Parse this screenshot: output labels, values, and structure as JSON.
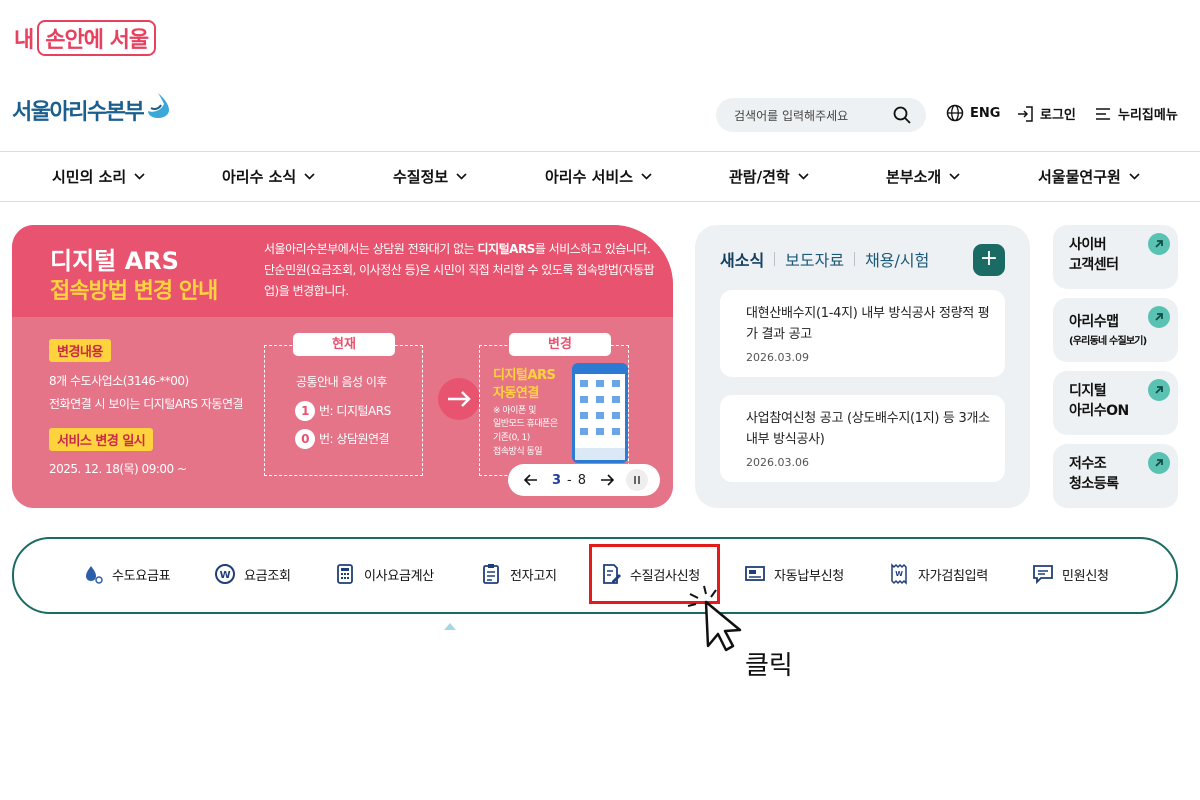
{
  "badge": {
    "prefix": "내",
    "boxed": "손안에 서울"
  },
  "header": {
    "logo_text": "서울아리수본부",
    "search_placeholder": "검색어를 입력해주세요",
    "lang_label": "ENG",
    "login_label": "로그인",
    "sitemap_label": "누리집메뉴"
  },
  "gnb": [
    "시민의 소리",
    "아리수 소식",
    "수질정보",
    "아리수 서비스",
    "관람/견학",
    "본부소개",
    "서울물연구원"
  ],
  "banner": {
    "title": "디지털 ARS",
    "subtitle": "접속방법 변경 안내",
    "desc_1": "서울아리수본부에서는 상담원 전화대기 없는 ",
    "desc_bold": "디지털ARS",
    "desc_2": "를 서비스하고 있습니다. 단순민원(요금조회, 이사정산 등)은 시민이 직접 처리할 수 있도록 접속방법(자동팝업)을 변경합니다.",
    "change_tag": "변경내용",
    "change_line1": "8개 수도사업소(3146-**00)",
    "change_line2": "전화연결 시 보이는 디지털ARS 자동연결",
    "date_tag": "서비스 변경 일시",
    "date_text": "2025. 12. 18(목) 09:00 ~",
    "current_label": "현재",
    "current_line": "공통안내 음성 이후",
    "current_opt1_num": "1",
    "current_opt1": "번: 디지털ARS",
    "current_opt2_num": "0",
    "current_opt2": "번: 상담원연결",
    "changed_label": "변경",
    "changed_title1": "디지털ARS",
    "changed_title2": "자동연결",
    "changed_note1": "※ 아이폰 및",
    "changed_note2": "일반모드 휴대폰은",
    "changed_note3": "기존(0, 1)",
    "changed_note4": "접속방식 동일",
    "pager_current": "3",
    "pager_sep": "-",
    "pager_total": "8"
  },
  "news": {
    "tabs": [
      "새소식",
      "보도자료",
      "채용/시험"
    ],
    "plus": "+",
    "items": [
      {
        "title": "대현산배수지(1-4지) 내부 방식공사 정량적 평가 결과 공고",
        "date": "2026.03.09"
      },
      {
        "title": "사업참여신청 공고 (상도배수지(1지) 등 3개소 내부 방식공사)",
        "date": "2026.03.06"
      }
    ]
  },
  "side": [
    {
      "line1": "사이버",
      "line2": "고객센터"
    },
    {
      "line1": "아리수맵",
      "line2": "(우리동네 수질보기)"
    },
    {
      "line1": "디지털",
      "line2": "아리수ON"
    },
    {
      "line1": "저수조",
      "line2": "청소등록"
    }
  ],
  "quick": [
    "수도요금표",
    "요금조회",
    "이사요금계산",
    "전자고지",
    "수질검사신청",
    "자동납부신청",
    "자가검침입력",
    "민원신청"
  ],
  "annotation": {
    "click_label": "클릭"
  },
  "colors": {
    "brand_pink": "#e8546f",
    "accent_teal": "#1a6b63",
    "highlight_red": "#e31b1b"
  }
}
